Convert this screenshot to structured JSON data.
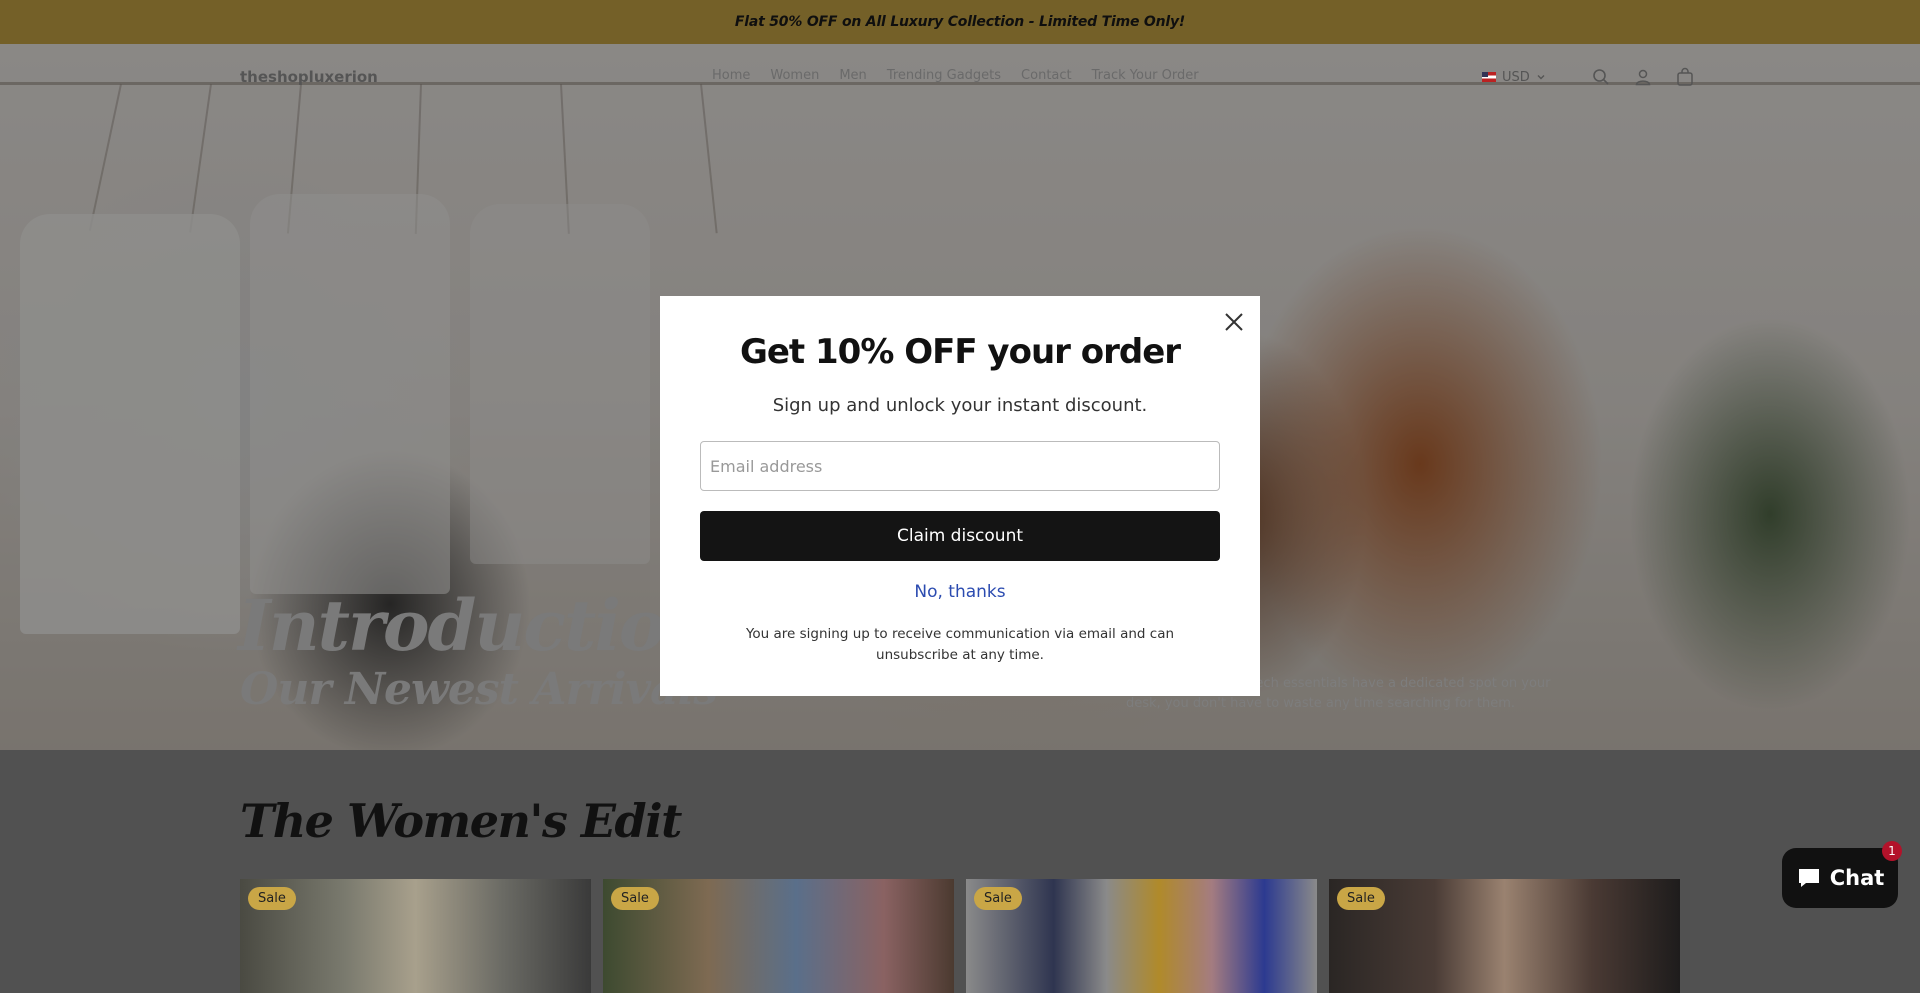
{
  "announcement": {
    "text": "Flat 50% OFF on All Luxury Collection - Limited Time Only!"
  },
  "header": {
    "logo": "theshopluxerion",
    "nav": [
      {
        "label": "Home"
      },
      {
        "label": "Women"
      },
      {
        "label": "Men"
      },
      {
        "label": "Trending Gadgets"
      },
      {
        "label": "Contact"
      },
      {
        "label": "Track Your Order"
      }
    ],
    "currency": "USD",
    "icons": [
      "search-icon",
      "account-icon",
      "cart-icon",
      "chevron-down-icon",
      "flag-us-icon"
    ]
  },
  "hero": {
    "title_line1": "Introduction",
    "title_line2": "Our Newest Arrivals",
    "text_line1": "ces. When all your tech essentials have a dedicated spot on your",
    "text_line2": "desk, you don't have to waste any time searching for them."
  },
  "section": {
    "title": "The Women's Edit",
    "cards": [
      {
        "badge": "Sale"
      },
      {
        "badge": "Sale"
      },
      {
        "badge": "Sale"
      },
      {
        "badge": "Sale"
      }
    ]
  },
  "modal": {
    "title": "Get 10% OFF your order",
    "subtitle": "Sign up and unlock your instant discount.",
    "email_placeholder": "Email address",
    "claim_label": "Claim discount",
    "decline_label": "No, thanks",
    "note": "You are signing up to receive communication via email and can unsubscribe at any time."
  },
  "chat": {
    "label": "Chat",
    "badge_count": "1"
  },
  "colors": {
    "announcement": "#c9a646",
    "badge": "#c9a646",
    "button": "#141414",
    "link": "#2b4bb0",
    "chat_badge": "#b3122a"
  }
}
